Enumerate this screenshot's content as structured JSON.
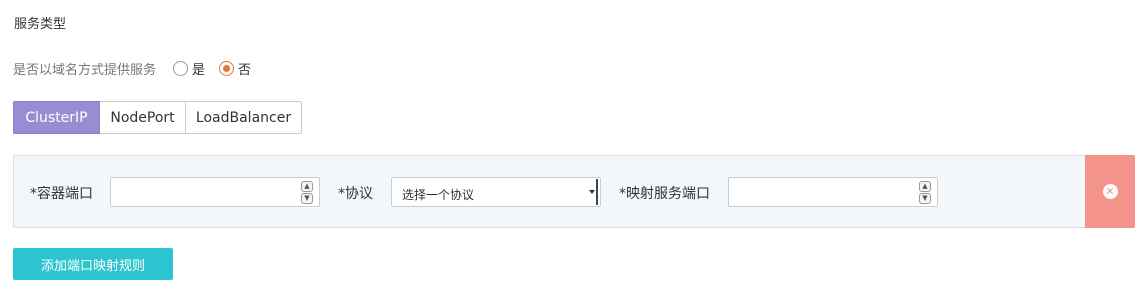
{
  "section_title": "服务类型",
  "domain_question": {
    "label": "是否以域名方式提供服务",
    "options": [
      {
        "label": "是",
        "checked": false
      },
      {
        "label": "否",
        "checked": true
      }
    ]
  },
  "service_types": {
    "tabs": [
      "ClusterIP",
      "NodePort",
      "LoadBalancer"
    ],
    "active": "ClusterIP"
  },
  "port_mapping": {
    "container_port_label": "*容器端口",
    "container_port_value": "",
    "protocol_label": "*协议",
    "protocol_selected": "选择一个协议",
    "service_port_label": "*映射服务端口",
    "service_port_value": "",
    "remove_icon": "close-circle-icon"
  },
  "add_rule_button": "添加端口映射规则",
  "colors": {
    "active_tab": "#9a8cd2",
    "radio_checked": "#e0763b",
    "remove_bg": "#f4938a",
    "add_button": "#2cc5cf",
    "row_bg": "#f2f7fc"
  }
}
